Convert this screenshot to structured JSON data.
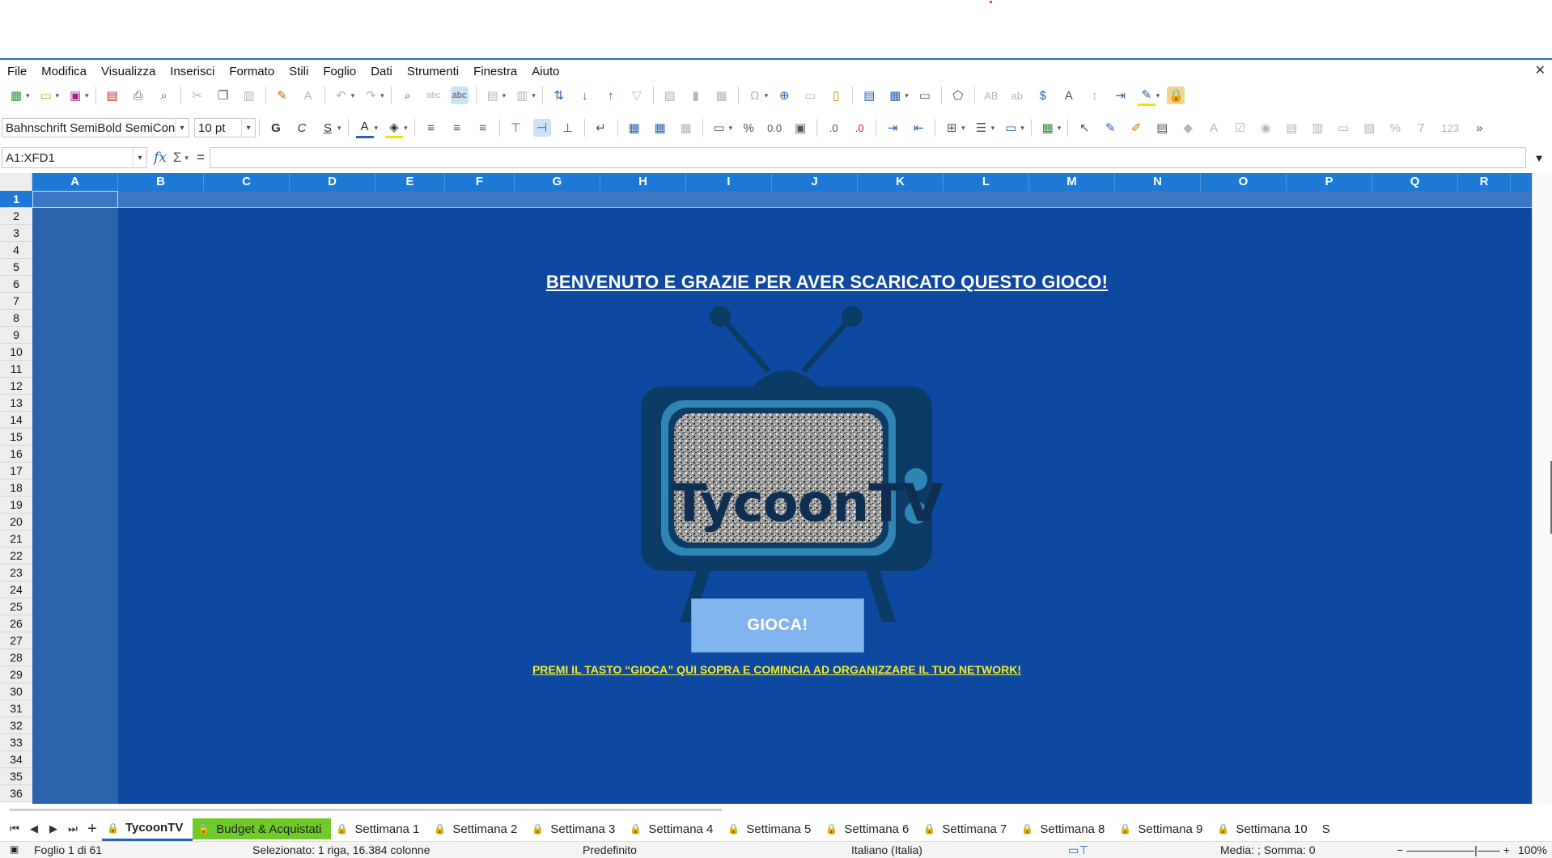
{
  "menu": [
    "File",
    "Modifica",
    "Visualizza",
    "Inserisci",
    "Formato",
    "Stili",
    "Foglio",
    "Dati",
    "Strumenti",
    "Finestra",
    "Aiuto"
  ],
  "toolbar": {
    "font_name": "Bahnschrift SemiBold SemiCon",
    "font_size": "10 pt",
    "bold": "G",
    "italic": "C",
    "underline": "S",
    "percent": "%",
    "number": "0.0",
    "number_format": "123",
    "currency": "$"
  },
  "formula_bar": {
    "name_box": "A1:XFD1",
    "fx": "fx",
    "sigma": "Σ",
    "equals": "=",
    "value": ""
  },
  "columns": [
    "A",
    "B",
    "C",
    "D",
    "E",
    "F",
    "G",
    "H",
    "I",
    "J",
    "K",
    "L",
    "M",
    "N",
    "O",
    "P",
    "Q",
    "R"
  ],
  "rows": [
    "1",
    "2",
    "3",
    "4",
    "5",
    "6",
    "7",
    "8",
    "9",
    "10",
    "11",
    "12",
    "13",
    "14",
    "15",
    "16",
    "17",
    "18",
    "19",
    "20",
    "21",
    "22",
    "23",
    "24",
    "25",
    "26",
    "27",
    "28",
    "29",
    "30",
    "31",
    "32",
    "33",
    "34",
    "35",
    "36"
  ],
  "content": {
    "welcome": "BENVENUTO E GRAZIE PER AVER SCARICATO QUESTO GIOCO!",
    "logo_text": "TycoonTV",
    "play_button": "GIOCA!",
    "hint": "PREMI IL TASTO “GIOCA” QUI SOPRA E COMINCIA AD ORGANIZZARE IL TUO NETWORK!"
  },
  "tabs": [
    {
      "label": "TycoonTV",
      "active": true
    },
    {
      "label": "Budget & Acquistati",
      "highlight": "#6fcb2a"
    },
    {
      "label": "Settimana 1"
    },
    {
      "label": "Settimana 2"
    },
    {
      "label": "Settimana 3"
    },
    {
      "label": "Settimana 4"
    },
    {
      "label": "Settimana 5"
    },
    {
      "label": "Settimana 6"
    },
    {
      "label": "Settimana 7"
    },
    {
      "label": "Settimana 8"
    },
    {
      "label": "Settimana 9"
    },
    {
      "label": "Settimana 10"
    },
    {
      "label": "S"
    }
  ],
  "status": {
    "sheet": "Foglio 1 di 61",
    "selection": "Selezionato: 1 riga, 16.384 colonne",
    "style": "Predefinito",
    "language": "Italiano (Italia)",
    "sum": "Media: ; Somma: 0",
    "zoom": "100%"
  },
  "colors": {
    "sheet_bg": "#0e48a0",
    "header_blue": "#1e78d6",
    "hint_yellow": "#f2ea2f",
    "play_button": "#82b5ee"
  }
}
